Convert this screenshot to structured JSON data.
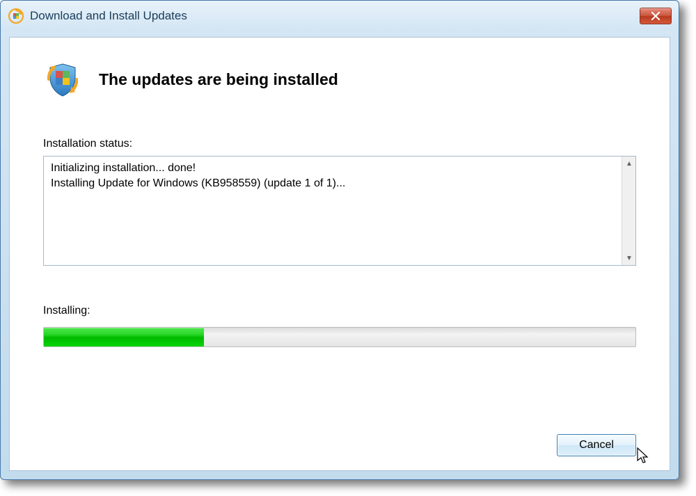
{
  "window": {
    "title": "Download and Install Updates"
  },
  "header": {
    "title": "The updates are being installed"
  },
  "status": {
    "label": "Installation status:",
    "lines": "Initializing installation... done!\nInstalling Update for Windows (KB958559) (update 1 of 1)... "
  },
  "progress": {
    "label": "Installing:",
    "percent": 27
  },
  "buttons": {
    "cancel": "Cancel"
  }
}
